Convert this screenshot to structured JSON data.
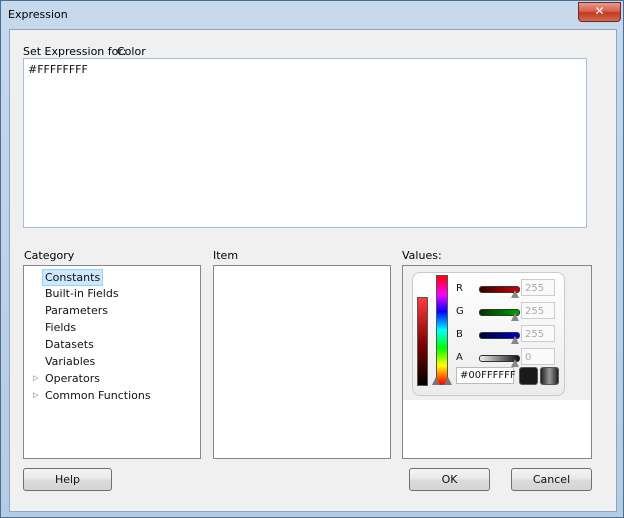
{
  "window": {
    "title": "Expression",
    "close_glyph": "✕"
  },
  "expression": {
    "label": "Set Expression for:",
    "target": "Color",
    "value": "#FFFFFFFF"
  },
  "category": {
    "label": "Category",
    "items": [
      {
        "label": "Constants",
        "selected": true
      },
      {
        "label": "Built-in Fields"
      },
      {
        "label": "Parameters"
      },
      {
        "label": "Fields"
      },
      {
        "label": "Datasets"
      },
      {
        "label": "Variables"
      },
      {
        "label": "Operators",
        "expandable": true
      },
      {
        "label": "Common Functions",
        "expandable": true
      }
    ],
    "expander_glyph": "▷"
  },
  "item": {
    "label": "Item"
  },
  "values": {
    "label": "Values:",
    "channels": [
      {
        "label": "R",
        "value": "255",
        "color": "#d40000"
      },
      {
        "label": "G",
        "value": "255",
        "color": "#00a000"
      },
      {
        "label": "B",
        "value": "255",
        "color": "#0000c8"
      },
      {
        "label": "A",
        "value": "0",
        "color": "#808080"
      }
    ],
    "hex": "#00FFFFFF"
  },
  "buttons": {
    "help": "Help",
    "ok": "OK",
    "cancel": "Cancel"
  }
}
